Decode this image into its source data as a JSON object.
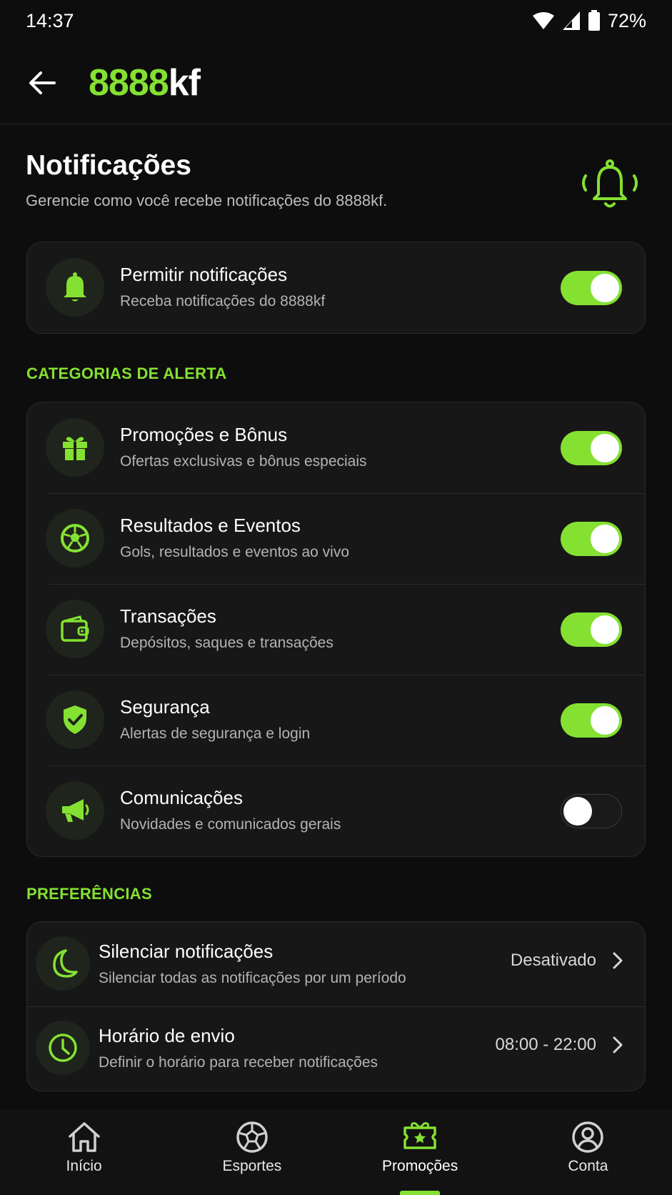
{
  "status_bar": {
    "time": "14:37",
    "battery": "72%"
  },
  "app_bar": {
    "logo_number": "8888",
    "logo_suffix": "kf"
  },
  "header": {
    "title": "Notificações",
    "subtitle": "Gerencie como você recebe notificações do 8888kf."
  },
  "master": {
    "title": "Permitir notificações",
    "subtitle": "Receba notificações do 8888kf",
    "enabled": true
  },
  "categories_label": "CATEGORIAS DE ALERTA",
  "categories": [
    {
      "title": "Promoções e Bônus",
      "subtitle": "Ofertas exclusivas e bônus especiais",
      "icon": "gift-icon",
      "enabled": true
    },
    {
      "title": "Resultados e Eventos",
      "subtitle": "Gols, resultados e eventos ao vivo",
      "icon": "soccer-ball-icon",
      "enabled": true
    },
    {
      "title": "Transações",
      "subtitle": "Depósitos, saques e transações",
      "icon": "wallet-icon",
      "enabled": true
    },
    {
      "title": "Segurança",
      "subtitle": "Alertas de segurança e login",
      "icon": "shield-check-icon",
      "enabled": true
    },
    {
      "title": "Comunicações",
      "subtitle": "Novidades e comunicados gerais",
      "icon": "megaphone-icon",
      "enabled": false
    }
  ],
  "preferences_label": "PREFERÊNCIAS",
  "preferences": [
    {
      "title": "Silenciar notificações",
      "subtitle": "Silenciar todas as notificações por um período",
      "value": "Desativado",
      "icon": "moon-icon"
    },
    {
      "title": "Horário de envio",
      "subtitle": "Definir o horário para receber notificações",
      "value": "08:00 - 22:00",
      "icon": "clock-icon"
    }
  ],
  "bottom_nav": [
    {
      "label": "Início",
      "icon": "home-icon",
      "active": false
    },
    {
      "label": "Esportes",
      "icon": "soccer-ball-icon",
      "active": false
    },
    {
      "label": "Promoções",
      "icon": "ticket-star-icon",
      "active": true
    },
    {
      "label": "Conta",
      "icon": "user-icon",
      "active": false
    }
  ],
  "colors": {
    "accent": "#84e132",
    "background": "#0d0d0d",
    "card": "#171717"
  }
}
